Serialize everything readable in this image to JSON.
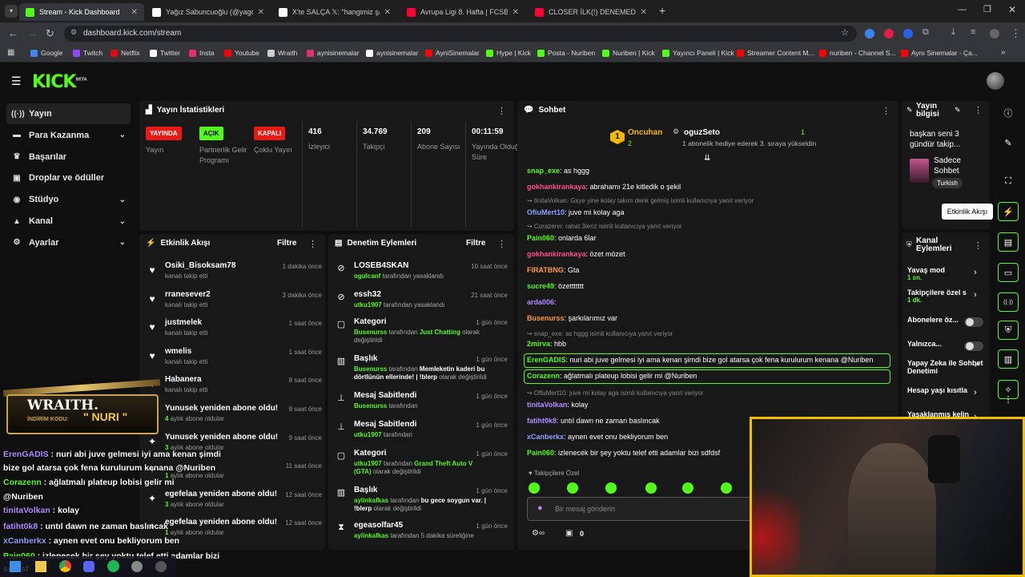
{
  "browser": {
    "tabs": [
      {
        "label": "Stream - Kick Dashboard",
        "color": "#53fc18"
      },
      {
        "label": "Yağız Sabuncuoğlu (@yagosabu",
        "color": "#ffffff"
      },
      {
        "label": "X'te SALÇA 𝕏: \"hangimiz şamp",
        "color": "#ffffff"
      },
      {
        "label": "Avrupa Ligi 8. Hafta | FCSB - Fe",
        "color": "#ff0033"
      },
      {
        "label": "CLOSER İLK(!) DENEMEDE BAŞA",
        "color": "#ff0033"
      }
    ],
    "url": "dashboard.kick.com/stream",
    "bookmarks": [
      "Google",
      "Twitch",
      "Netflix",
      "Twitter",
      "Insta",
      "Youtube",
      "Wraith",
      "aynisinemalar",
      "aynisinemalar",
      "AyniSinemalar",
      "Hype | Kick",
      "Posta - Nuriben",
      "Nuriben | Kick",
      "Yayıncı Paneli | Kick",
      "Streamer Content M...",
      "nuriben - Channel S...",
      "Aynı Sinemalar - Ça..."
    ],
    "bookmark_colors": [
      "#4285f4",
      "#9146ff",
      "#e50914",
      "#ffffff",
      "#e1306c",
      "#ff0000",
      "#cccccc",
      "#e1306c",
      "#ffffff",
      "#ff0000",
      "#53fc18",
      "#53fc18",
      "#53fc18",
      "#53fc18",
      "#ff0000",
      "#ff0000",
      "#ff0000"
    ]
  },
  "kick": {
    "logo": "KICK",
    "logo_sup": "BETA"
  },
  "sidebar": {
    "items": [
      {
        "label": "Yayın",
        "icon": "broadcast-icon"
      },
      {
        "label": "Para Kazanma",
        "icon": "money-icon"
      },
      {
        "label": "Başarılar",
        "icon": "trophy-icon"
      },
      {
        "label": "Droplar ve ödüller",
        "icon": "gift-icon"
      },
      {
        "label": "Stüdyo",
        "icon": "studio-icon"
      },
      {
        "label": "Kanal",
        "icon": "channel-icon"
      },
      {
        "label": "Ayarlar",
        "icon": "gear-icon"
      }
    ]
  },
  "stats": {
    "title": "Yayın İstatistikleri",
    "items": [
      {
        "badge": "YAYINDA",
        "label": "Yayın"
      },
      {
        "badge": "AÇIK",
        "label": "Partnerlik Gelir Programı"
      },
      {
        "badge": "KAPALI",
        "label": "Çoklu Yayın"
      },
      {
        "value": "416",
        "label": "İzleyici"
      },
      {
        "value": "34.769",
        "label": "Takipçi"
      },
      {
        "value": "209",
        "label": "Abone Sayısı"
      },
      {
        "value": "00:11:59",
        "label": "Yayında Olduğu Süre"
      }
    ]
  },
  "activity": {
    "title": "Etkinlik Akışı",
    "filter": "Filtre",
    "items": [
      {
        "name": "Osiki_Bisoksam78",
        "sub": "kanalı takip etti",
        "time": "1 dakika önce",
        "icon": "heart"
      },
      {
        "name": "rranesever2",
        "sub": "kanalı takip etti",
        "time": "3 dakika önce",
        "icon": "heart"
      },
      {
        "name": "justmelek",
        "sub": "kanalı takip etti",
        "time": "1 saat önce",
        "icon": "heart"
      },
      {
        "name": "wmelis",
        "sub": "kanalı takip etti",
        "time": "1 saat önce",
        "icon": "heart"
      },
      {
        "name": "Habanera",
        "sub": "kanalı takip etti",
        "time": "8 saat önce",
        "icon": "heart"
      },
      {
        "name": "Yunusek yeniden abone oldu!",
        "sub_n": "4",
        "sub": "aylık abone oldular",
        "time": "9 saat önce",
        "icon": "star"
      },
      {
        "name": "Yunusek yeniden abone oldu!",
        "sub_n": "3",
        "sub": "aylık abone oldular",
        "time": "9 saat önce",
        "icon": "star"
      },
      {
        "name": "",
        "sub_n": "1",
        "sub": "aylık abone oldular",
        "time": "11 saat önce",
        "icon": "star"
      },
      {
        "name": "egefelaa yeniden abone oldu!",
        "sub_n": "3",
        "sub": "aylık abone oldular",
        "time": "12 saat önce",
        "icon": "star"
      },
      {
        "name": "egefelaa yeniden abone oldu!",
        "sub_n": "1",
        "sub": "aylık abone oldular",
        "time": "12 saat önce",
        "icon": "star"
      }
    ]
  },
  "moderation": {
    "title": "Denetim Eylemleri",
    "filter": "Filtre",
    "items": [
      {
        "title": "LOSEB4SKAN",
        "actor": "ogulcanf",
        "text": " tarafından yasaklandı",
        "time": "10 saat önce",
        "icon": "ban"
      },
      {
        "title": "essh32",
        "actor": "utku1907",
        "text": " tarafından yasaklandı",
        "time": "21 saat önce",
        "icon": "ban"
      },
      {
        "title": "Kategori",
        "actor": "Busenurss",
        "text": " tarafından ",
        "strong": "Just Chatting",
        "tail": " olarak değiştirildi",
        "time": "1 gün önce",
        "icon": "category"
      },
      {
        "title": "Başlık",
        "actor": "Busenurss",
        "text": " tarafından ",
        "white": "Memleketin kaderi bu dörtlünün ellerinde! | !blerp",
        "tail": " olarak değiştirildi",
        "time": "1 gün önce",
        "icon": "title"
      },
      {
        "title": "Mesaj Sabitlendi",
        "actor": "Busenurss",
        "text": " tarafından",
        "time": "1 gün önce",
        "icon": "pin"
      },
      {
        "title": "Mesaj Sabitlendi",
        "actor": "utku1907",
        "text": " tarafından",
        "time": "1 gün önce",
        "icon": "pin"
      },
      {
        "title": "Kategori",
        "actor": "utku1907",
        "text": " tarafından ",
        "strong": "Grand Theft Auto V (GTA)",
        "tail": " olarak değiştirildi",
        "time": "1 gün önce",
        "icon": "category"
      },
      {
        "title": "Başlık",
        "actor": "aylinkafkas",
        "text": " tarafından ",
        "white": "bu gece soygun var. | !blerp",
        "tail": " olarak değiştirildi",
        "time": "1 gün önce",
        "icon": "title"
      },
      {
        "title": "egeasolfar45",
        "actor": "aylinkafkas",
        "text": " tarafından 5 dakika süreliğine",
        "time": "1 gün önce",
        "icon": "timeout"
      }
    ]
  },
  "chat": {
    "title": "Sohbet",
    "pinned": {
      "gifter": "Oncuhan",
      "count": "2",
      "recipient": "oguzSeto",
      "count2": "1",
      "text": "1 abonelik hediye ederek 3. sıraya yükseldin"
    },
    "messages": [
      {
        "user": "snap_exe",
        "color": "#53fc18",
        "text": ": as hggg"
      },
      {
        "user": "gokhankirankaya",
        "color": "#ff4e8a",
        "text": ": abrahamı 21e kitledik o şekil"
      },
      {
        "reply": "tinitaVolkan: Gsye yine kolay takım denk gelmiş isimli kullanıcıya yanıt veriyor"
      },
      {
        "user": "OfiuMert10",
        "color": "#8ea1ff",
        "text": ": juve mi kolay aga"
      },
      {
        "reply": "Corazenn: rahat 3leriz isimli kullanıcıya yanıt veriyor"
      },
      {
        "user": "Pain060",
        "color": "#53fc18",
        "text": ": onlarda 6lar"
      },
      {
        "user": "gokhankirankaya",
        "color": "#ff4e8a",
        "text": ": özet mözet"
      },
      {
        "user": "FIRATBNG",
        "color": "#ff9a3c",
        "text": ": Gta"
      },
      {
        "user": "sucre49",
        "color": "#53fc18",
        "text": ": özettttttt"
      },
      {
        "user": "arda006",
        "color": "#b18cff",
        "text": ": "
      },
      {
        "user": "Busenurss",
        "color": "#ff9a3c",
        "text": ": şarkılarımız var"
      },
      {
        "reply": "snap_exe: as hggg isimli kullanıcıya yanıt veriyor"
      },
      {
        "user": "2mirva",
        "color": "#53fc18",
        "text": ": hbb"
      },
      {
        "user": "ErenGADIS",
        "color": "#53fc18",
        "text": ": nuri abi juve gelmesi iyi ama kenan şimdi bize gol atarsa çok fena kurulurum kenana @Nuriben",
        "hl": true
      },
      {
        "user": "Corazenn",
        "color": "#53fc18",
        "text": ": ağlatmalı plateup lobisi gelir mi @Nuriben",
        "hl": true
      },
      {
        "reply": "OfluMert10: juve mi kolay aga isimli kullanıcıya yanıt veriyor"
      },
      {
        "user": "tinitaVolkan",
        "color": "#b18cff",
        "text": ": kolay"
      },
      {
        "user": "fatiht0k8",
        "color": "#b18cff",
        "text": ": untıl dawn ne zaman baslıncak"
      },
      {
        "user": "xCanberkx",
        "color": "#8ea1ff",
        "text": ": aynen evet onu bekliyorum ben"
      },
      {
        "user": "Pain060",
        "color": "#53fc18",
        "text": ": izlenecek bir şey yoktu telef etti adamlar bizi sdfdsf"
      }
    ],
    "followers_only": "Takipçilere Özel",
    "placeholder": "Bir mesaj gönderin",
    "counter": "0"
  },
  "stream_info": {
    "title": "Yayın bilgisi",
    "desc": "başkan seni 3 gündür takip...",
    "category": "Sadece Sohbet",
    "tag": "Turkish"
  },
  "channel_actions": {
    "title": "Kanal Eylemleri",
    "items": [
      {
        "label": "Yavaş mod",
        "sub": "1 sn.",
        "type": "chevron"
      },
      {
        "label": "Takipçilere özel s",
        "sub": "1 dk.",
        "type": "chevron"
      },
      {
        "label": "Abonelere öz...",
        "type": "toggle"
      },
      {
        "label": "Yalnızca...",
        "type": "toggle"
      },
      {
        "label": "Yapay Zeka ile Sohbet Denetimi",
        "type": "external"
      },
      {
        "label": "Hesap yaşı kısıtla",
        "type": "chevron"
      },
      {
        "label": "Yasaklanmış kelin",
        "type": "chevron"
      }
    ]
  },
  "tooltip": "Etkinlik Akışı",
  "overlay": {
    "brand": "WRAITH.",
    "code_label": "İNDİRİM KODU:",
    "code": "\" NURI \"",
    "lines": [
      {
        "user": "ErenGADIS",
        "color": "#b18cff",
        "text": " : nuri abi juve gelmesi iyi ama kenan şimdi"
      },
      {
        "user": "",
        "color": "#fff",
        "text": "bize gol atarsa çok fena kurulurum kenana @Nuriben"
      },
      {
        "user": "Corazenn",
        "color": "#53fc18",
        "text": " : ağlatmalı plateup lobisi gelir mi"
      },
      {
        "user": "",
        "color": "#fff",
        "text": "@Nuriben"
      },
      {
        "user": "tinitaVolkan",
        "color": "#b18cff",
        "text": " : kolay"
      },
      {
        "user": "fatiht0k8",
        "color": "#b18cff",
        "text": " : untıl dawn ne zaman baslıncak"
      },
      {
        "user": "xCanberkx",
        "color": "#8ea1ff",
        "text": " : aynen evet onu bekliyorum ben"
      },
      {
        "user": "Pain060",
        "color": "#53fc18",
        "text": " : izlenecek bir şey yoktu telef etti adamlar bizi"
      },
      {
        "user": "",
        "color": "#fff",
        "text": "sdfdsf"
      }
    ]
  },
  "colors": {
    "accent": "#53fc18",
    "live": "#e91916",
    "panel": "#181818",
    "bg": "#0f0f0f"
  }
}
